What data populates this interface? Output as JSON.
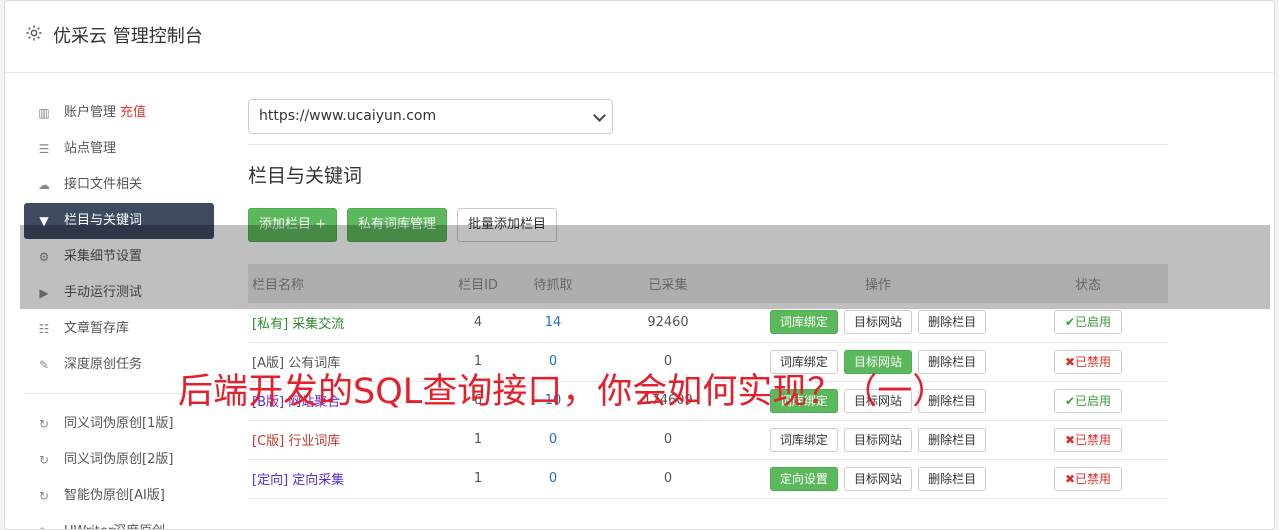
{
  "header": {
    "title": "优采云 管理控制台",
    "icon": "gear-icon"
  },
  "sidebar": {
    "items": [
      {
        "label": "账户管理",
        "badge": "充值",
        "icon": "bar-chart-icon"
      },
      {
        "label": "站点管理",
        "icon": "server-icon"
      },
      {
        "label": "接口文件相关",
        "icon": "cloud-upload-icon"
      },
      {
        "label": "栏目与关键词",
        "icon": "filter-icon",
        "active": true
      },
      {
        "label": "采集细节设置",
        "icon": "cogs-icon"
      },
      {
        "label": "手动运行测试",
        "icon": "play-icon"
      },
      {
        "label": "文章暂存库",
        "icon": "database-icon"
      },
      {
        "label": "深度原创任务",
        "icon": "edit-icon"
      }
    ],
    "items2": [
      {
        "label": "同义词伪原创[1版]",
        "icon": "refresh-icon"
      },
      {
        "label": "同义词伪原创[2版]",
        "icon": "refresh-icon"
      },
      {
        "label": "智能伪原创[AI版]",
        "icon": "refresh-icon"
      },
      {
        "label": "UWriter深度原创",
        "icon": "edit-icon"
      }
    ]
  },
  "main": {
    "site_select": "https://www.ucaiyun.com",
    "section_title": "栏目与关键词",
    "buttons": {
      "add": "添加栏目 +",
      "private_lib": "私有词库管理",
      "batch_add": "批量添加栏目"
    },
    "table": {
      "headers": [
        "栏目名称",
        "栏目ID",
        "待抓取",
        "已采集",
        "操作",
        "状态"
      ],
      "rows": [
        {
          "tag": "[私有]",
          "name": "采集交流",
          "id": "4",
          "pending": "14",
          "collected": "92460",
          "op1": "词库绑定",
          "op2": "目标网站",
          "op3": "删除栏目",
          "status": "✔已启用",
          "color": "green",
          "op1g": true,
          "op2g": false
        },
        {
          "tag": "[A版]",
          "name": "公有词库",
          "id": "1",
          "pending": "0",
          "collected": "0",
          "op1": "词库绑定",
          "op2": "目标网站",
          "op3": "删除栏目",
          "status": "✖已禁用",
          "color": "dark",
          "op1g": false,
          "op2g": true
        },
        {
          "tag": "[B版]",
          "name": "网站聚合",
          "id": "6",
          "pending": "10",
          "collected": "174609",
          "op1": "词库绑定",
          "op2": "目标网站",
          "op3": "删除栏目",
          "status": "✔已启用",
          "color": "purple",
          "op1g": true,
          "op2g": false
        },
        {
          "tag": "[C版]",
          "name": "行业词库",
          "id": "1",
          "pending": "0",
          "collected": "0",
          "op1": "词库绑定",
          "op2": "目标网站",
          "op3": "删除栏目",
          "status": "✖已禁用",
          "color": "red",
          "op1g": false,
          "op2g": false
        },
        {
          "tag": "[定向]",
          "name": "定向采集",
          "id": "1",
          "pending": "0",
          "collected": "0",
          "op1": "定向设置",
          "op2": "目标网站",
          "op3": "删除栏目",
          "status": "✖已禁用",
          "color": "purple",
          "op1g": true,
          "op2g": false
        }
      ]
    }
  },
  "watermark": "后端开发的SQL查询接口，你会如何实现？（一）"
}
